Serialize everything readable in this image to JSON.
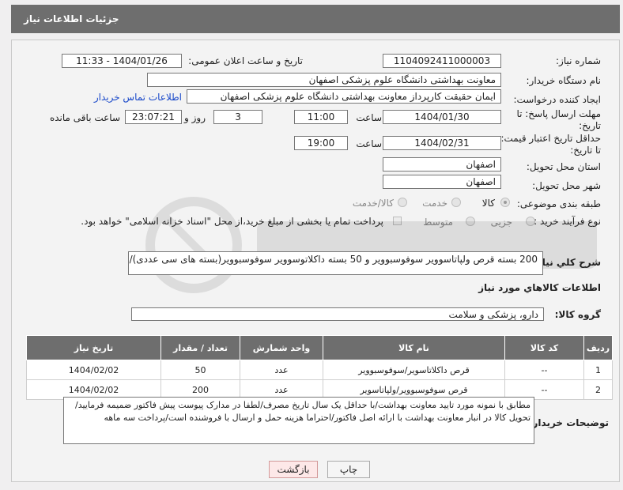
{
  "header": {
    "title": "جزئیات اطلاعات نیاز"
  },
  "fields": {
    "need_number_label": "شماره نیاز:",
    "need_number": "1104092411000003",
    "announce_label": "تاریخ و ساعت اعلان عمومی:",
    "announce_value": "1404/01/26 - 11:33",
    "buyer_org_label": "نام دستگاه خریدار:",
    "buyer_org": "معاونت بهداشتی دانشگاه علوم پزشکی اصفهان",
    "creator_label": "ایجاد کننده درخواست:",
    "creator": "ایمان حقیقت کارپرداز معاونت بهداشتی دانشگاه علوم پزشکی اصفهان",
    "contact_link": "اطلاعات تماس خریدار",
    "reply_deadline_label_1": "مهلت ارسال پاسخ: تا",
    "reply_deadline_label_2": "تاریخ:",
    "reply_date": "1404/01/30",
    "time_label": "ساعت",
    "reply_time": "11:00",
    "days_value": "3",
    "days_label": "روز و",
    "remaining_time": "23:07:21",
    "remaining_label": "ساعت باقی مانده",
    "price_validity_label_1": "حداقل تاریخ اعتبار قیمت:",
    "price_validity_label_2": "تا تاریخ:",
    "price_date": "1404/02/31",
    "price_time": "19:00",
    "province_label": "استان محل تحویل:",
    "province": "اصفهان",
    "city_label": "شهر محل تحویل:",
    "city": "اصفهان",
    "category_label": "طبقه بندی موضوعی:",
    "category_options": [
      "کالا",
      "خدمت",
      "کالا/خدمت"
    ],
    "process_label": "نوع فرآیند خرید :",
    "process_options": [
      "جزیی",
      "متوسط"
    ],
    "payment_note": "پرداخت تمام یا بخشی از مبلغ خرید،از محل \"اسناد خزانه اسلامی\" خواهد بود."
  },
  "description": {
    "label": "شرح كلي نياز:",
    "text": "200 بسته قرص ولپاتاسوویر سوفوسبوویر و 50 بسته داکلاتوسوویر سوفوسبوویر(بسته های سی عددی)/"
  },
  "goods": {
    "section_title": "اطلاعات كالاهاي مورد نياز",
    "group_label": "گروه كالا:",
    "group_value": "دارو، پزشکی و سلامت",
    "columns": [
      "ردیف",
      "کد کالا",
      "نام کالا",
      "واحد شمارش",
      "تعداد / مقدار",
      "تاریخ نیاز"
    ],
    "rows": [
      [
        "1",
        "--",
        "قرص داکلاتاسویر/سوفوسبوویر",
        "عدد",
        "50",
        "1404/02/02"
      ],
      [
        "2",
        "--",
        "قرص سوفوسبوویر/ولپاتاسویر",
        "عدد",
        "200",
        "1404/02/02"
      ]
    ]
  },
  "buyer_notes": {
    "label": "توضیحات خریدار:",
    "line1": "مطابق با نمونه مورد تایید معاونت بهداشت/با حداقل یک سال تاریخ مصرف/لطفا در مدارک پیوست پیش فاکتور ضمیمه فرمایید/",
    "line2": "تحویل کالا در انبار معاونت بهداشت با ارائه اصل فاکتور/احتراما هزینه حمل و ارسال با فروشنده است/پرداخت سه ماهه"
  },
  "buttons": {
    "print": "چاپ",
    "back": "بازگشت"
  },
  "colors": {
    "header_bg": "#6e6e6e",
    "link": "#1a49c9",
    "back_button_bg": "#fde8e8"
  }
}
